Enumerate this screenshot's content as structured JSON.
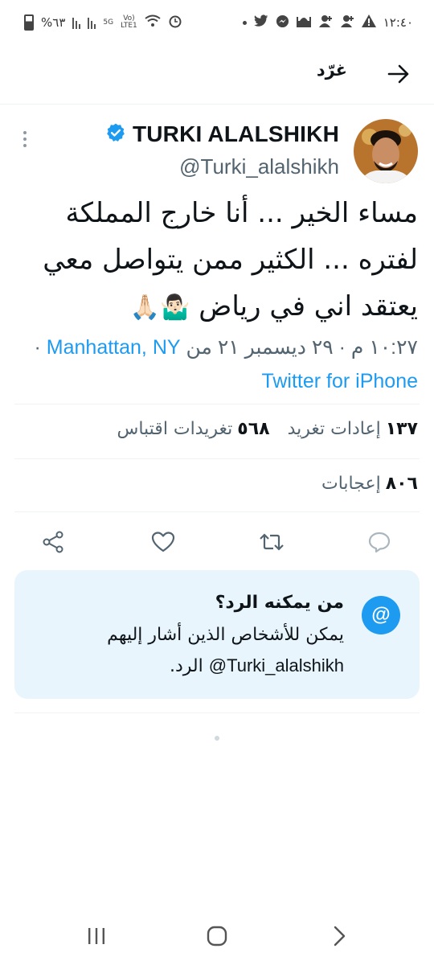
{
  "status_bar": {
    "time": "١٢:٤٠",
    "battery": "%٦٣",
    "network_5g": "5G",
    "volte_top": "Vo)",
    "volte_bottom": "LTE1"
  },
  "header": {
    "title": "غرّد"
  },
  "tweet": {
    "display_name": "TURKI ALALSHIKH",
    "handle": "@Turki_alalshikh",
    "text_lines": [
      "مساء الخير ... أنا خارج المملكة",
      "لفتره ... الكثير ممن يتواصل معي",
      "يعتقد اني في رياض"
    ],
    "text_emoji": "🤷🏻‍♂️🙏🏻",
    "timestamp": "١٠:٢٧ م · ٢٩ ديسمبر ٢١ من",
    "location": "Manhattan, NY",
    "separator": "·",
    "source": "Twitter for iPhone"
  },
  "stats": {
    "retweets_count": "١٣٧",
    "retweets_label": "إعادات تغريد",
    "quotes_count": "٥٦٨",
    "quotes_label": "تغريدات اقتباس",
    "likes_count": "٨٠٦",
    "likes_label": "إعجابات"
  },
  "reply_card": {
    "icon_text": "@",
    "title": "من يمكنه الرد؟",
    "body_line1": "يمكن للأشخاص الذين أشار إليهم",
    "body_handle": "@Turki_alalshikh",
    "body_end": "الرد."
  },
  "colors": {
    "accent": "#1d9bf0",
    "card_bg": "#e8f5fd",
    "secondary_text": "#536471"
  }
}
